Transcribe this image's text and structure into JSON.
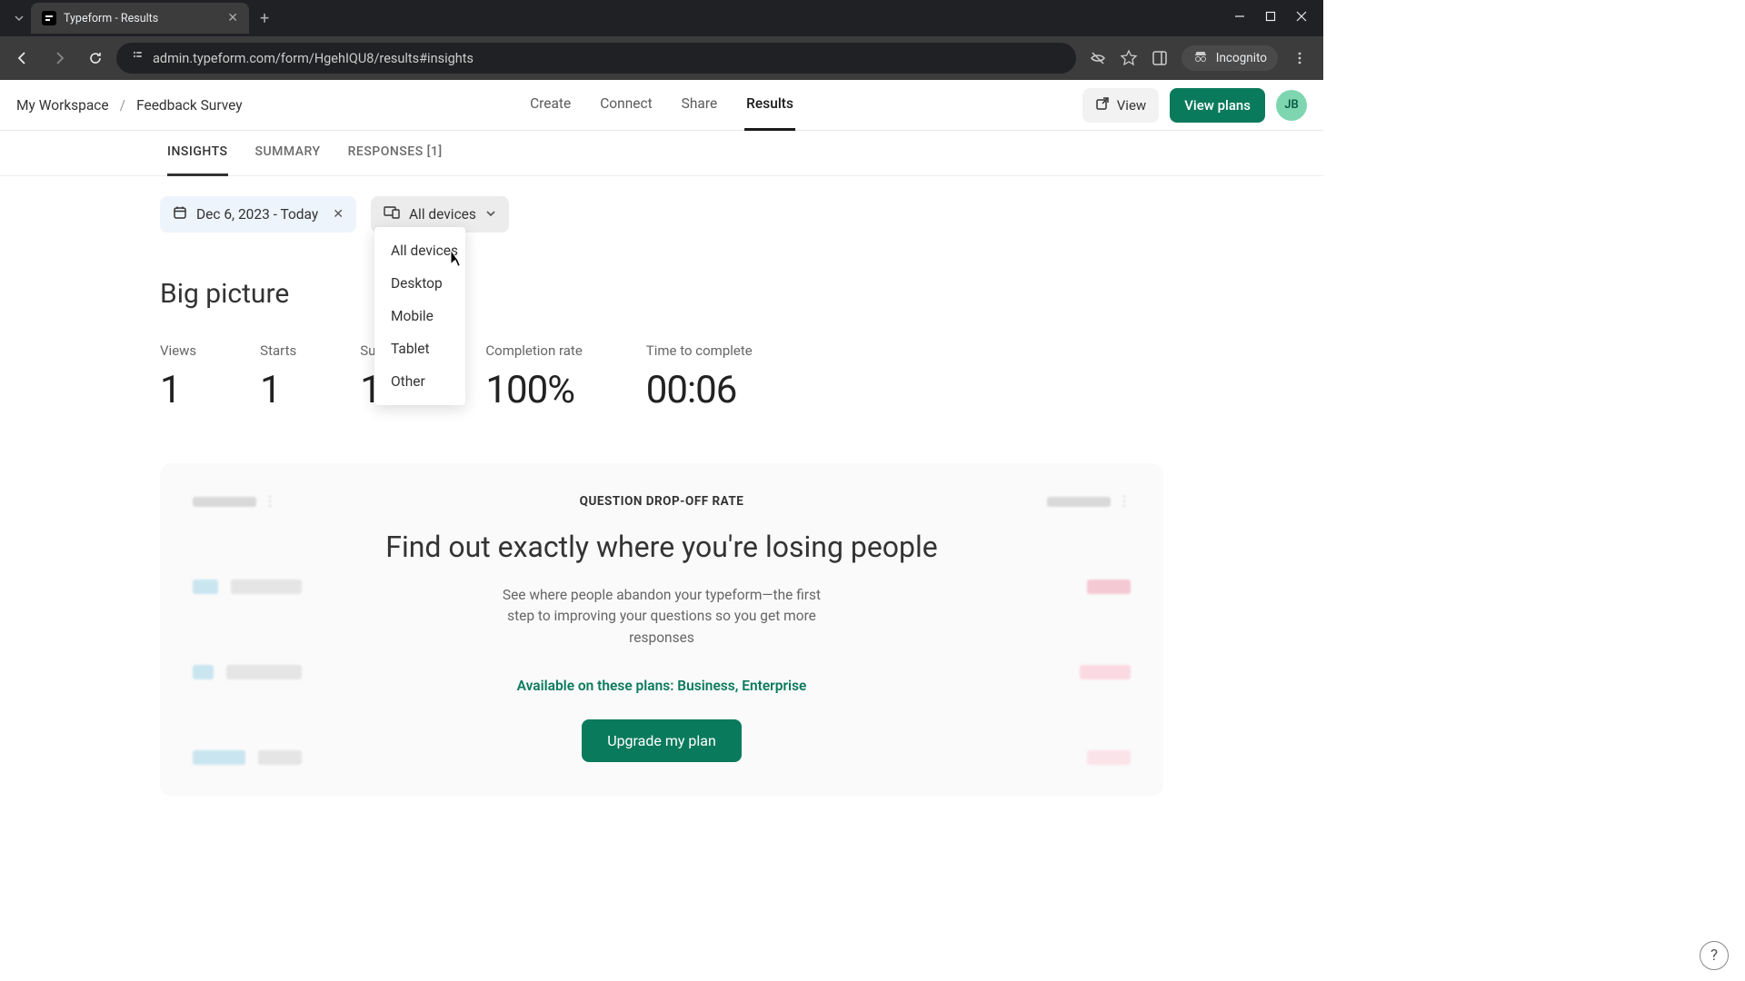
{
  "browser": {
    "tab_title": "Typeform - Results",
    "url": "admin.typeform.com/form/HgehIQU8/results#insights",
    "incognito_label": "Incognito"
  },
  "header": {
    "breadcrumb_root": "My Workspace",
    "breadcrumb_current": "Feedback Survey",
    "tabs": {
      "create": "Create",
      "connect": "Connect",
      "share": "Share",
      "results": "Results"
    },
    "view_label": "View",
    "plans_label": "View plans",
    "avatar_initials": "JB"
  },
  "subtabs": {
    "insights": "INSIGHTS",
    "summary": "SUMMARY",
    "responses": "RESPONSES [1]"
  },
  "filters": {
    "date_label": "Dec 6, 2023 - Today",
    "devices_label": "All devices",
    "devices_dropdown": [
      "All devices",
      "Desktop",
      "Mobile",
      "Tablet",
      "Other"
    ]
  },
  "big_picture": {
    "title": "Big picture",
    "metrics": [
      {
        "label": "Views",
        "value": "1"
      },
      {
        "label": "Starts",
        "value": "1"
      },
      {
        "label": "Submissions",
        "value": "1"
      },
      {
        "label": "Completion rate",
        "value": "100%"
      },
      {
        "label": "Time to complete",
        "value": "00:06"
      }
    ]
  },
  "dropoff": {
    "kicker": "QUESTION DROP-OFF RATE",
    "headline": "Find out exactly where you're losing people",
    "body": "See where people abandon your typeform—the first step to improving your questions so you get more responses",
    "plans_note": "Available on these plans: Business, Enterprise",
    "cta": "Upgrade my plan"
  }
}
